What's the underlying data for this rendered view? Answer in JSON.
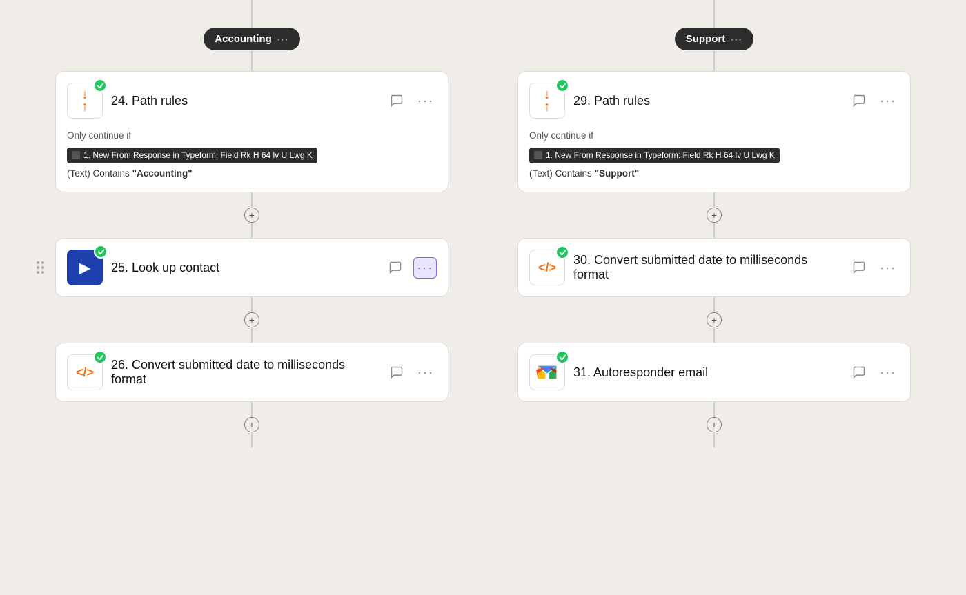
{
  "branches": [
    {
      "id": "accounting",
      "pill_label": "Accounting",
      "pill_dots": "···",
      "steps": [
        {
          "id": "step-24",
          "type": "path-rules",
          "number": "24.",
          "title": "Path rules",
          "condition_label": "Only continue if",
          "tag_text": "1. New From Response in Typeform: Field Rk H 64 lv U Lwg K",
          "condition_suffix": "(Text) Contains",
          "condition_value": "\"Accounting\"",
          "has_drag": false
        },
        {
          "id": "step-25",
          "type": "lookup",
          "number": "25.",
          "title": "Look up contact",
          "has_drag": true,
          "more_active": true
        },
        {
          "id": "step-26",
          "type": "code",
          "number": "26.",
          "title": "Convert submitted date to milliseconds format",
          "has_drag": false
        }
      ]
    },
    {
      "id": "support",
      "pill_label": "Support",
      "pill_dots": "···",
      "steps": [
        {
          "id": "step-29",
          "type": "path-rules",
          "number": "29.",
          "title": "Path rules",
          "condition_label": "Only continue if",
          "tag_text": "1. New From Response in Typeform: Field Rk H 64 lv U Lwg K",
          "condition_suffix": "(Text) Contains",
          "condition_value": "\"Support\"",
          "has_drag": false
        },
        {
          "id": "step-30",
          "type": "code",
          "number": "30.",
          "title": "Convert submitted date to milliseconds format",
          "has_drag": false
        },
        {
          "id": "step-31",
          "type": "gmail",
          "number": "31.",
          "title": "Autoresponder email",
          "has_drag": false
        }
      ]
    }
  ],
  "add_button_label": "+",
  "dots_label": "···"
}
